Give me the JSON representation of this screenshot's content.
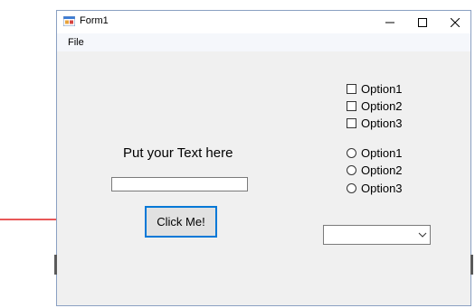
{
  "window": {
    "title": "Form1",
    "controls": {
      "minimize_icon": "minimize-icon",
      "maximize_icon": "maximize-icon",
      "close_icon": "close-icon"
    }
  },
  "menu": {
    "items": [
      {
        "label": "File"
      }
    ]
  },
  "form": {
    "label_text": "Put your Text here",
    "textbox_value": "",
    "button_label": "Click Me!",
    "checkboxes": [
      {
        "label": "Option1",
        "checked": false
      },
      {
        "label": "Option2",
        "checked": false
      },
      {
        "label": "Option3",
        "checked": false
      }
    ],
    "radios": [
      {
        "label": "Option1",
        "selected": false
      },
      {
        "label": "Option2",
        "selected": false
      },
      {
        "label": "Option3",
        "selected": false
      }
    ],
    "combobox_value": ""
  },
  "annotation": {
    "arrow_color": "#e02020",
    "button_focus_color": "#0078d7"
  }
}
